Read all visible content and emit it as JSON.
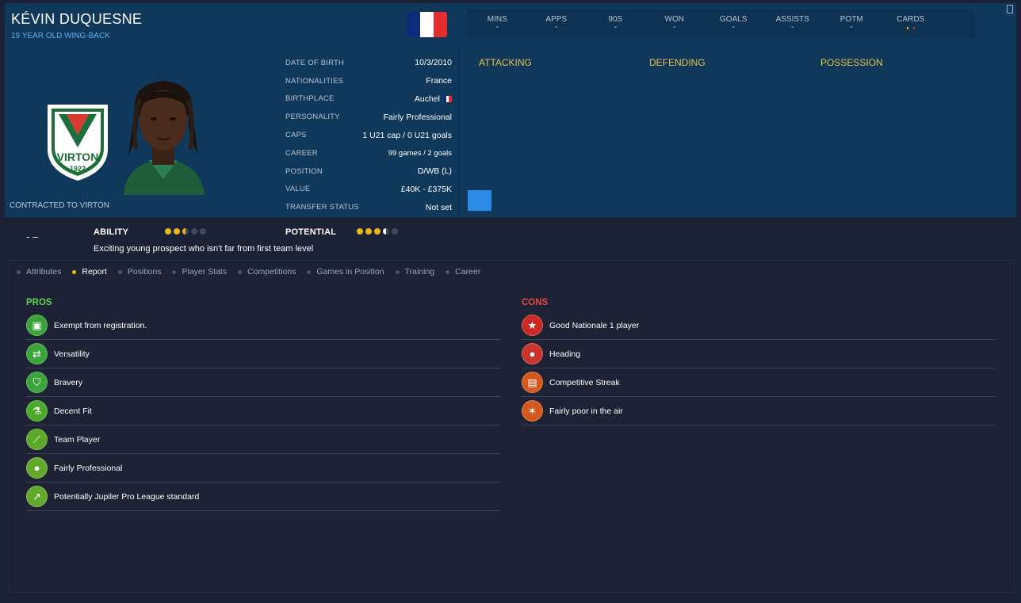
{
  "player": {
    "name": "KÉVIN DUQUESNE",
    "subtitle": "19 YEAR OLD WING-BACK",
    "contracted": "CONTRACTED TO VIRTON"
  },
  "club": {
    "badge_text": "VIRTON",
    "badge_year": "1922"
  },
  "info": [
    {
      "label": "DATE OF BIRTH",
      "value": "10/3/2010"
    },
    {
      "label": "NATIONALITIES",
      "value": "France"
    },
    {
      "label": "BIRTHPLACE",
      "value": "Auchel",
      "flag": true
    },
    {
      "label": "PERSONALITY",
      "value": "Fairly Professional"
    },
    {
      "label": "CAPS",
      "value": "1 U21 cap / 0 U21 goals"
    },
    {
      "label": "CAREER",
      "value": "99 games /   2 goals"
    },
    {
      "label": "POSITION",
      "value": "D/WB (L)"
    },
    {
      "label": "VALUE",
      "value": "£40K - £375K"
    },
    {
      "label": "TRANSFER STATUS",
      "value": "Not set"
    }
  ],
  "stats": [
    {
      "label": "MINS",
      "value": "-"
    },
    {
      "label": "APPS",
      "value": "-"
    },
    {
      "label": "90S",
      "value": "-"
    },
    {
      "label": "WON",
      "value": "-"
    },
    {
      "label": "GOALS",
      "value": "-"
    },
    {
      "label": "ASSISTS",
      "value": "-"
    },
    {
      "label": "POTM",
      "value": "-"
    },
    {
      "label": "CARDS",
      "value": ""
    }
  ],
  "categories": {
    "attacking": "ATTACKING",
    "defending": "DEFENDING",
    "possession": "POSSESSION"
  },
  "rating": {
    "dash": "- –",
    "ability_label": "ABILITY",
    "ability_stars": 2.5,
    "potential_label": "POTENTIAL",
    "potential_stars": 3.5,
    "description": "Exciting young prospect who isn't far from first team level"
  },
  "tabs": [
    {
      "label": "Attributes",
      "active": false
    },
    {
      "label": "Report",
      "active": true
    },
    {
      "label": "Positions",
      "active": false
    },
    {
      "label": "Player Stats",
      "active": false
    },
    {
      "label": "Competitions",
      "active": false
    },
    {
      "label": "Games in Position",
      "active": false
    },
    {
      "label": "Training",
      "active": false
    },
    {
      "label": "Career",
      "active": false
    }
  ],
  "pros": {
    "title": "PROS",
    "items": [
      {
        "text": "Exempt from registration.",
        "icon": "registration-icon"
      },
      {
        "text": "Versatility",
        "icon": "versatility-icon"
      },
      {
        "text": "Bravery",
        "icon": "bravery-icon"
      },
      {
        "text": "Decent Fit",
        "icon": "flask-icon"
      },
      {
        "text": "Team Player",
        "icon": "team-player-icon"
      },
      {
        "text": "Fairly Professional",
        "icon": "head-icon"
      },
      {
        "text": "Potentially Jupiler Pro League standard",
        "icon": "trend-up-icon"
      }
    ]
  },
  "cons": {
    "title": "CONS",
    "items": [
      {
        "text": "Good Nationale 1 player",
        "icon": "star-icon"
      },
      {
        "text": "Heading",
        "icon": "heading-icon"
      },
      {
        "text": "Competitive Streak",
        "icon": "competitive-icon"
      },
      {
        "text": "Fairly poor in the air",
        "icon": "aerial-icon"
      }
    ]
  },
  "colors": {
    "header_bg": "#10385a",
    "accent_blue": "#56b1ee",
    "pros_green": "#4aa82a",
    "pros_title": "#5fd35c",
    "cons_red": "#c82b25",
    "cons_orange": "#d2581c",
    "cons_title": "#e84a4a",
    "category_yellow": "#e9c04a"
  }
}
